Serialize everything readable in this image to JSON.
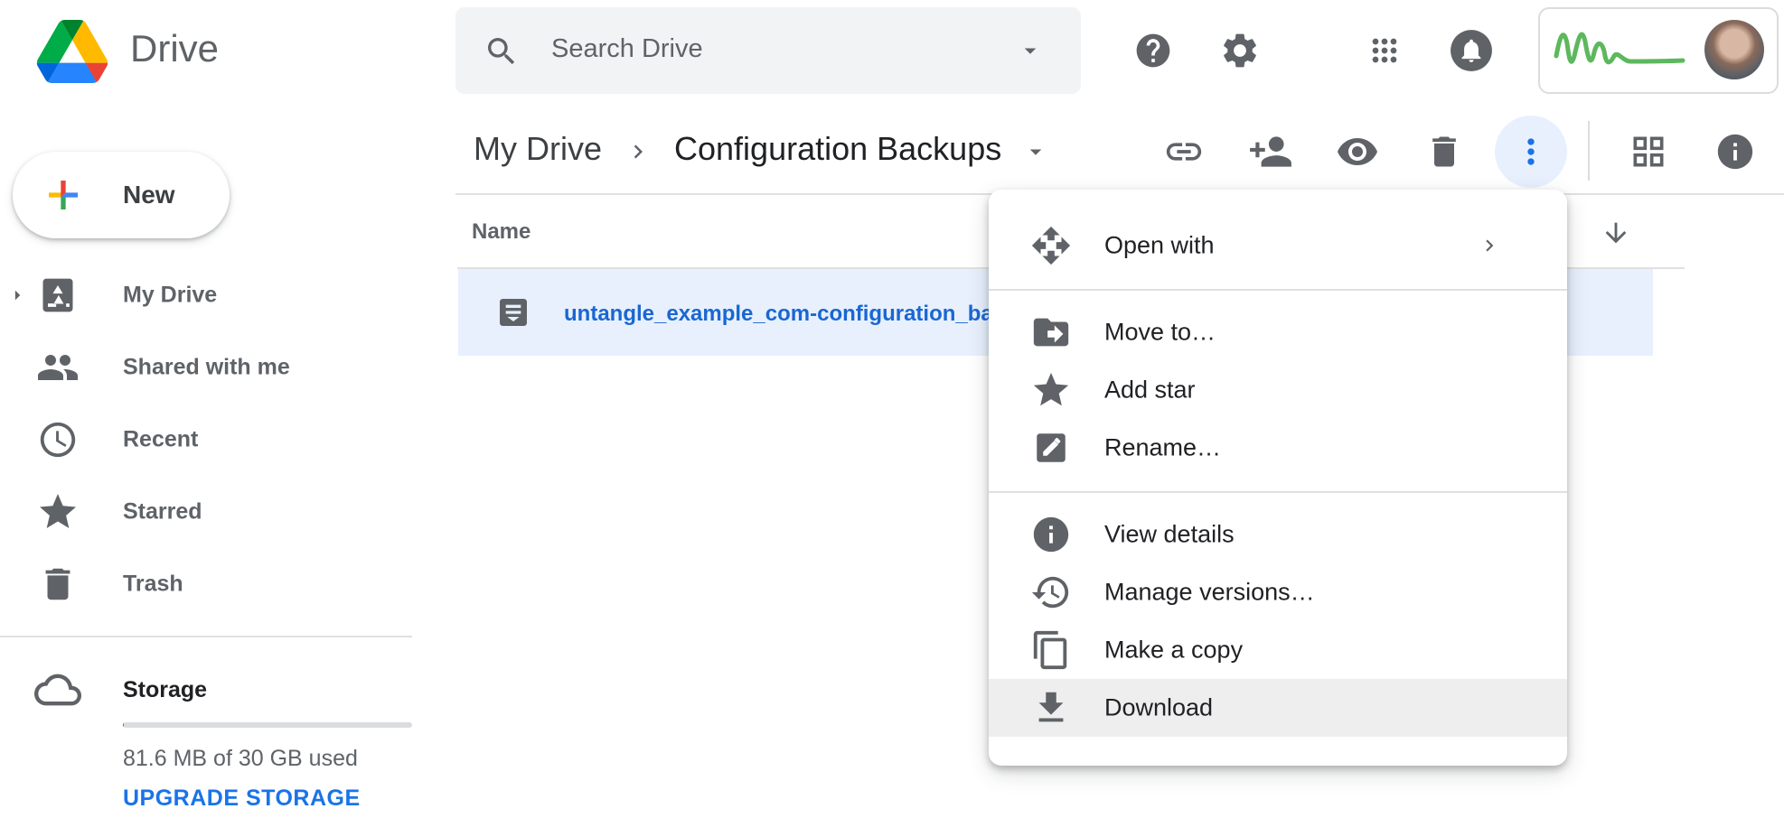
{
  "app": {
    "name": "Drive"
  },
  "search": {
    "placeholder": "Search Drive"
  },
  "breadcrumb": {
    "root": "My Drive",
    "current": "Configuration Backups"
  },
  "new_button": {
    "label": "New"
  },
  "sidebar": {
    "items": [
      {
        "label": "My Drive",
        "icon": "my-drive-icon"
      },
      {
        "label": "Shared with me",
        "icon": "people-icon"
      },
      {
        "label": "Recent",
        "icon": "clock-icon"
      },
      {
        "label": "Starred",
        "icon": "star-icon"
      },
      {
        "label": "Trash",
        "icon": "trash-icon"
      }
    ]
  },
  "storage": {
    "label": "Storage",
    "used_text": "81.6 MB of 30 GB used",
    "used_fraction": 0.0027,
    "upgrade_label": "UPGRADE STORAGE"
  },
  "file_list": {
    "column_name": "Name",
    "files": [
      {
        "name": "untangle_example_com-configuration_ba",
        "icon": "document-icon"
      }
    ]
  },
  "context_menu": {
    "items": [
      {
        "label": "Open with",
        "icon": "open-with-icon",
        "has_submenu": true
      },
      {
        "label": "Move to…",
        "icon": "move-to-folder-icon"
      },
      {
        "label": "Add star",
        "icon": "star-icon"
      },
      {
        "label": "Rename…",
        "icon": "rename-icon"
      },
      {
        "label": "View details",
        "icon": "info-icon"
      },
      {
        "label": "Manage versions…",
        "icon": "history-icon"
      },
      {
        "label": "Make a copy",
        "icon": "copy-icon"
      },
      {
        "label": "Download",
        "icon": "download-icon",
        "highlighted": true
      }
    ]
  },
  "colors": {
    "accent": "#1a73e8",
    "selected_row": "#e8f0fe",
    "icon_gray": "#5f6368",
    "menu_hover": "#eeeeee",
    "signature_green": "#5cb85c"
  }
}
